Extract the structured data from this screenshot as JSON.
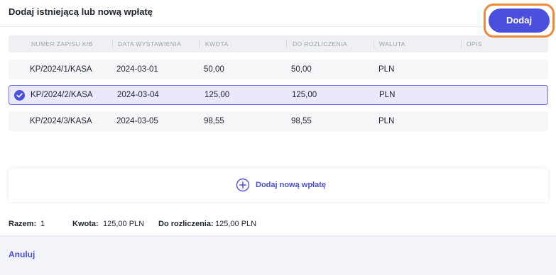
{
  "dialog": {
    "title": "Dodaj istniejącą lub nową wpłatę"
  },
  "table": {
    "columns": [
      "NUMER ZAPISU K/B",
      "DATA WYSTAWIENIA",
      "KWOTA",
      "DO ROZLICZENIA",
      "WALUTA",
      "OPIS"
    ],
    "rows": [
      {
        "number": "KP/2024/1/KASA",
        "date": "2024-03-01",
        "amount": "50,00",
        "to_settle": "50,00",
        "currency": "PLN",
        "description": "",
        "selected": false
      },
      {
        "number": "KP/2024/2/KASA",
        "date": "2024-03-04",
        "amount": "125,00",
        "to_settle": "125,00",
        "currency": "PLN",
        "description": "",
        "selected": true
      },
      {
        "number": "KP/2024/3/KASA",
        "date": "2024-03-05",
        "amount": "98,55",
        "to_settle": "98,55",
        "currency": "PLN",
        "description": "",
        "selected": false
      }
    ]
  },
  "add_new": {
    "label": "Dodaj nową wpłatę",
    "icon": "plus-circle-icon"
  },
  "summary": {
    "total_label": "Razem:",
    "total_value": "1",
    "amount_label": "Kwota:",
    "amount_value": "125,00 PLN",
    "to_settle_label": "Do rozliczenia:",
    "to_settle_value": "125,00 PLN"
  },
  "footer": {
    "cancel_label": "Anuluj",
    "submit_label": "Dodaj"
  },
  "colors": {
    "accent": "#4a50dd",
    "highlight_outline": "#f08a3a",
    "selected_row_bg": "#e9e9fb"
  }
}
